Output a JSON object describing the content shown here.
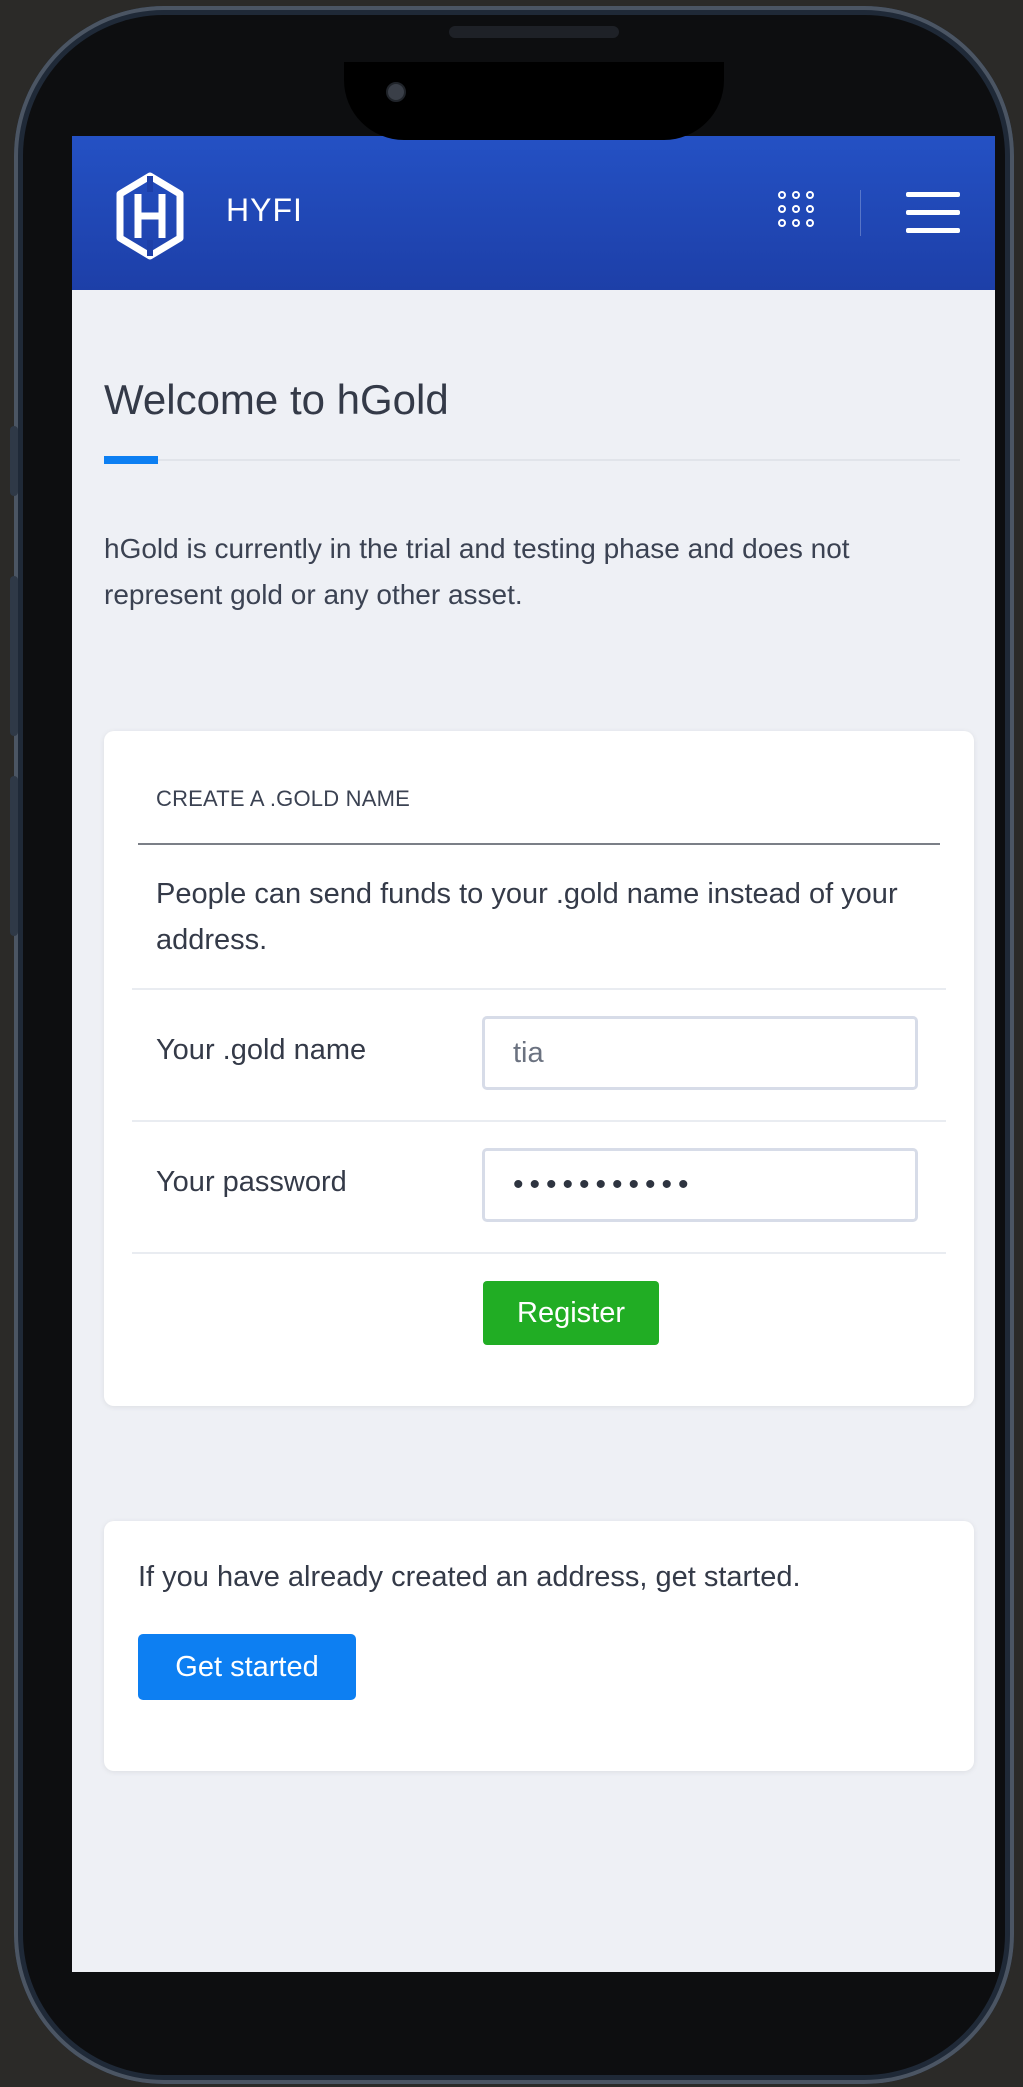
{
  "header": {
    "brand": "HYFI",
    "apps_icon": "grid-dots-icon",
    "menu_icon": "hamburger-menu-icon"
  },
  "page": {
    "title": "Welcome to hGold",
    "intro": "hGold is currently in the trial and testing phase and does not represent gold or any other asset."
  },
  "register_card": {
    "header": "CREATE A .GOLD NAME",
    "description": "People can send funds to your .gold name instead of your address.",
    "name_label": "Your .gold name",
    "name_value": "tia",
    "password_label": "Your password",
    "password_value": "•••••••••••",
    "register_label": "Register"
  },
  "start_card": {
    "text": "If you have already created an address, get started.",
    "button_label": "Get started"
  },
  "colors": {
    "navbar": "#2451c4",
    "accent_blue": "#0d7ff2",
    "register_green": "#21ad24",
    "page_bg": "#eef0f5"
  }
}
